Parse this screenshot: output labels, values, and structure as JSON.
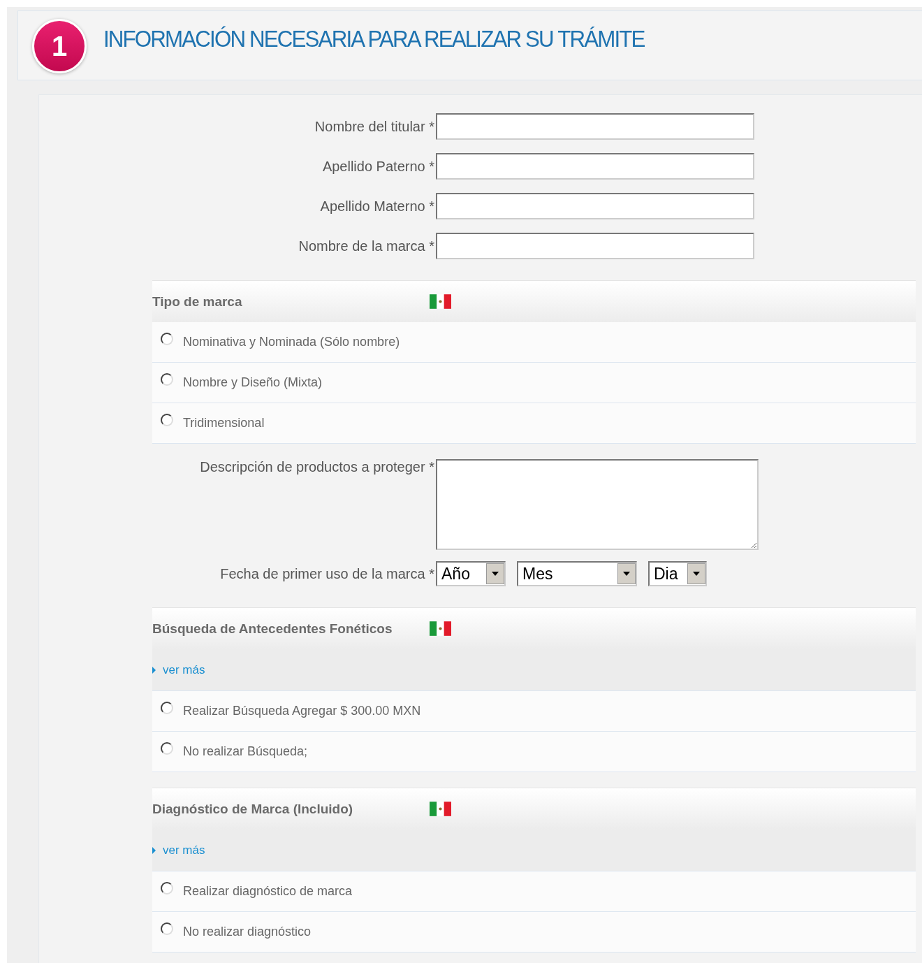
{
  "header": {
    "step": "1",
    "title": "INFORMACIÓN NECESARIA PARA REALIZAR SU TRÁMITE"
  },
  "fields": [
    {
      "label": "Nombre del titular",
      "required": "*"
    },
    {
      "label": "Apellido Paterno",
      "required": "*"
    },
    {
      "label": "Apellido Materno",
      "required": "*"
    },
    {
      "label": "Nombre de la marca",
      "required": "*"
    }
  ],
  "brand_type": {
    "title": "Tipo de marca",
    "options": [
      {
        "label": "Nominativa y Nominada (Sólo nombre)",
        "selected": false
      },
      {
        "label": "Nombre y Diseño (Mixta)",
        "selected": false
      },
      {
        "label": "Tridimensional",
        "selected": false
      }
    ]
  },
  "description": {
    "label": "Descripción de productos a proteger",
    "required": "*"
  },
  "first_use": {
    "label": "Fecha de primer uso de la marca",
    "required": "*",
    "selects": [
      {
        "value": "Año"
      },
      {
        "value": "Mes"
      },
      {
        "value": "Dia"
      }
    ]
  },
  "sections": [
    {
      "title": "Búsqueda de Antecedentes Fonéticos",
      "link": "ver más",
      "options": [
        {
          "label": "Realizar Búsqueda Agregar $ 300.00 MXN",
          "selected": false
        },
        {
          "label": "No realizar Búsqueda;",
          "selected": false
        }
      ]
    },
    {
      "title": "Diagnóstico de Marca (Incluido)",
      "link": "ver más",
      "options": [
        {
          "label": "Realizar diagnóstico de marca",
          "selected": false
        },
        {
          "label": "No realizar diagnóstico",
          "selected": false
        }
      ]
    }
  ]
}
